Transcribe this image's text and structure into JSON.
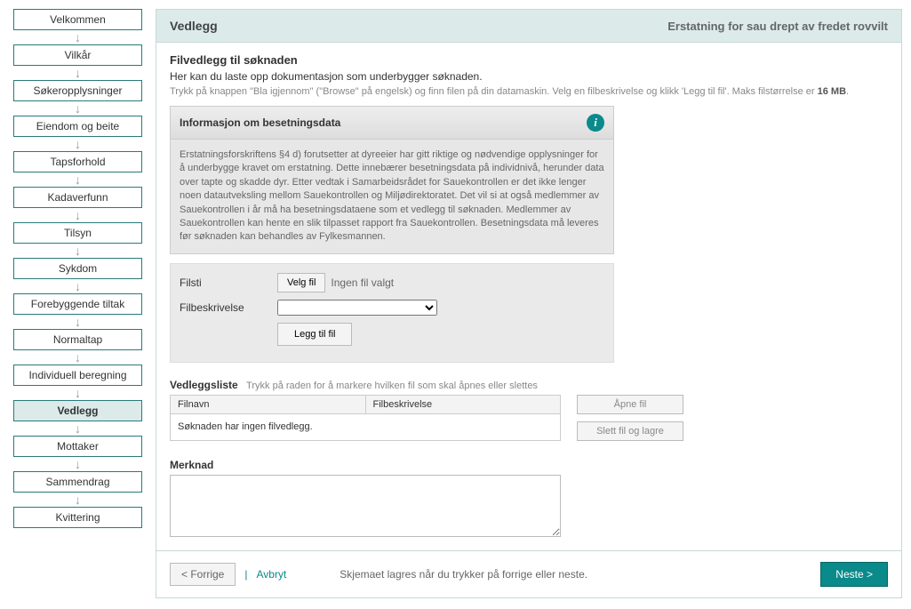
{
  "sidebar": {
    "steps": [
      {
        "label": "Velkommen",
        "active": false
      },
      {
        "label": "Vilkår",
        "active": false
      },
      {
        "label": "Søkeropplysninger",
        "active": false
      },
      {
        "label": "Eiendom og beite",
        "active": false
      },
      {
        "label": "Tapsforhold",
        "active": false
      },
      {
        "label": "Kadaverfunn",
        "active": false
      },
      {
        "label": "Tilsyn",
        "active": false
      },
      {
        "label": "Sykdom",
        "active": false
      },
      {
        "label": "Forebyggende tiltak",
        "active": false
      },
      {
        "label": "Normaltap",
        "active": false
      },
      {
        "label": "Individuell beregning",
        "active": false
      },
      {
        "label": "Vedlegg",
        "active": true
      },
      {
        "label": "Mottaker",
        "active": false
      },
      {
        "label": "Sammendrag",
        "active": false
      },
      {
        "label": "Kvittering",
        "active": false
      }
    ]
  },
  "header": {
    "title": "Vedlegg",
    "subtitle": "Erstatning for sau drept av fredet rovvilt"
  },
  "intro": {
    "heading": "Filvedlegg til søknaden",
    "desc": "Her kan du laste opp dokumentasjon som underbygger søknaden.",
    "help_pre": "Trykk på knappen \"Bla igjennom\" (\"Browse\" på engelsk) og finn filen på din datamaskin. Velg en filbeskrivelse og klikk 'Legg til fil'. Maks filstørrelse er ",
    "help_bold": "16 MB",
    "help_post": "."
  },
  "infobox": {
    "title": "Informasjon om besetningsdata",
    "icon_glyph": "i",
    "body": "Erstatningsforskriftens §4 d) forutsetter at dyreeier har gitt riktige og nødvendige opplysninger for å underbygge kravet om erstatning. Dette innebærer besetningsdata på individnivå, herunder data over tapte og skadde dyr. Etter vedtak i Samarbeidsrådet for Sauekontrollen er det ikke lenger noen datautveksling mellom Sauekontrollen og Miljødirektoratet. Det vil si at også medlemmer av Sauekontrollen i år må ha besetningsdataene som et vedlegg til søknaden. Medlemmer av Sauekontrollen kan hente en slik tilpasset rapport fra Sauekontrollen. Besetningsdata må leveres før søknaden kan behandles av Fylkesmannen."
  },
  "fileform": {
    "path_label": "Filsti",
    "choose_btn": "Velg fil",
    "no_file": "Ingen fil valgt",
    "desc_label": "Filbeskrivelse",
    "add_btn": "Legg til fil"
  },
  "filelist": {
    "heading": "Vedleggsliste",
    "hint": "Trykk på raden for å markere hvilken fil som skal åpnes eller slettes",
    "col_name": "Filnavn",
    "col_desc": "Filbeskrivelse",
    "empty": "Søknaden har ingen filvedlegg.",
    "open_btn": "Åpne fil",
    "delete_btn": "Slett fil og lagre"
  },
  "merknad": {
    "label": "Merknad"
  },
  "footer": {
    "prev": "< Forrige",
    "separator": "|",
    "cancel": "Avbryt",
    "hint": "Skjemaet lagres når du trykker på forrige eller neste.",
    "next": "Neste >"
  }
}
